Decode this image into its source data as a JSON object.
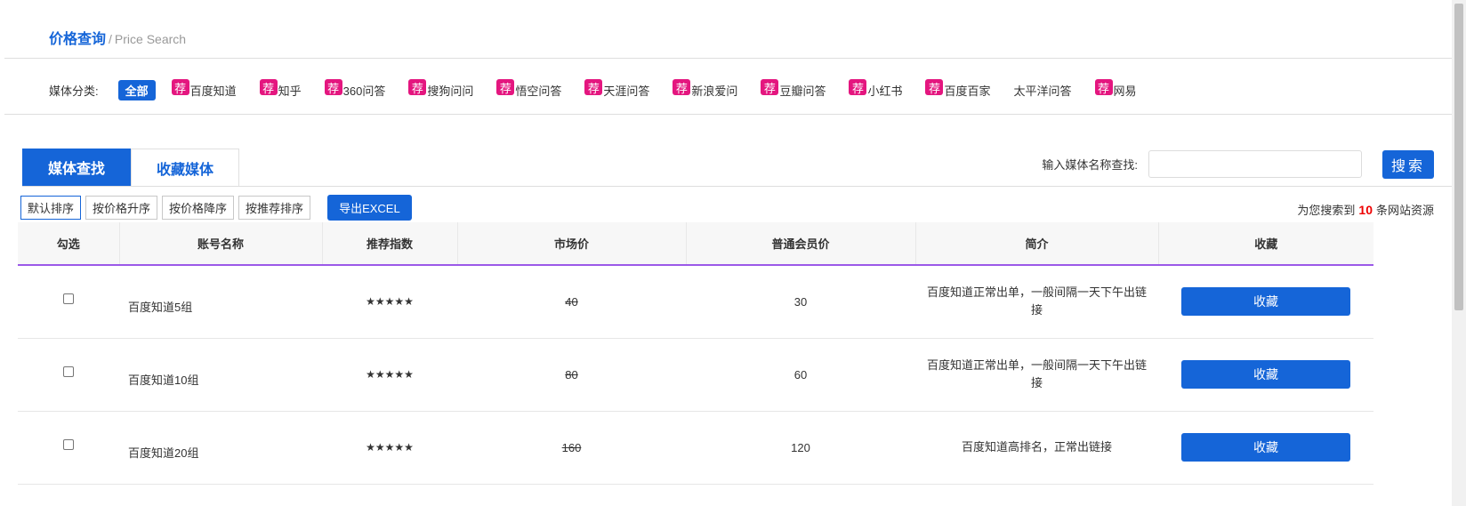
{
  "breadcrumb": {
    "main": "价格查询",
    "sep": "/",
    "sub": "Price Search"
  },
  "categories": {
    "label": "媒体分类:",
    "badge_text": "荐",
    "items": [
      {
        "label": "全部",
        "active": true,
        "badge": false
      },
      {
        "label": "百度知道",
        "badge": true
      },
      {
        "label": "知乎",
        "badge": true
      },
      {
        "label": "360问答",
        "badge": true
      },
      {
        "label": "搜狗问问",
        "badge": true
      },
      {
        "label": "悟空问答",
        "badge": true
      },
      {
        "label": "天涯问答",
        "badge": true
      },
      {
        "label": "新浪爱问",
        "badge": true
      },
      {
        "label": "豆瓣问答",
        "badge": true
      },
      {
        "label": "小红书",
        "badge": true
      },
      {
        "label": "百度百家",
        "badge": true
      },
      {
        "label": "太平洋问答",
        "badge": false
      },
      {
        "label": "网易",
        "badge": true
      }
    ]
  },
  "tabs": [
    {
      "label": "媒体查找",
      "active": true
    },
    {
      "label": "收藏媒体",
      "active": false
    }
  ],
  "search": {
    "label": "输入媒体名称查找:",
    "placeholder": "",
    "value": "",
    "button": "搜索"
  },
  "sort": {
    "buttons": [
      "默认排序",
      "按价格升序",
      "按价格降序",
      "按推荐排序"
    ],
    "export": "导出EXCEL"
  },
  "result": {
    "prefix": "为您搜索到",
    "count": "10",
    "suffix": "条网站资源"
  },
  "table": {
    "headers": [
      "勾选",
      "账号名称",
      "推荐指数",
      "市场价",
      "普通会员价",
      "简介",
      "收藏"
    ],
    "rows": [
      {
        "name": "百度知道5组",
        "stars": "★★★★★",
        "market": "40",
        "member": "30",
        "intro": "百度知道正常出单，一般间隔一天下午出链接",
        "fav": "收藏"
      },
      {
        "name": "百度知道10组",
        "stars": "★★★★★",
        "market": "80",
        "member": "60",
        "intro": "百度知道正常出单，一般间隔一天下午出链接",
        "fav": "收藏"
      },
      {
        "name": "百度知道20组",
        "stars": "★★★★★",
        "market": "160",
        "member": "120",
        "intro": "百度知道高排名，正常出链接",
        "fav": "收藏"
      }
    ]
  },
  "colors": {
    "accent": "#1565d8",
    "badge": "#e4167f",
    "header_rule": "#9b59e8",
    "count": "#ee0000"
  }
}
